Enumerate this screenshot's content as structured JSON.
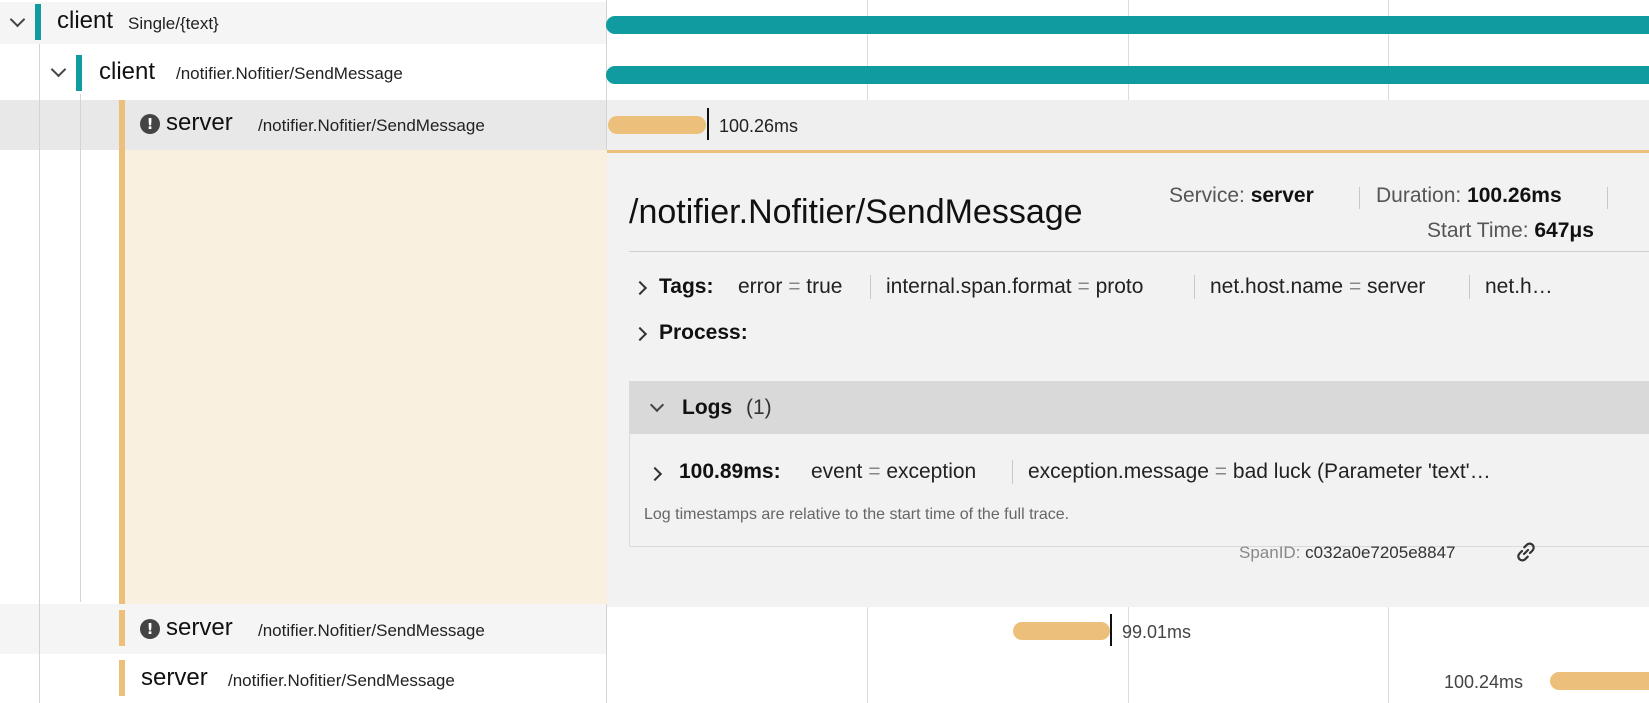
{
  "rows": [
    {
      "service": "client",
      "operation": "Single/{text}",
      "color": "#109ba0",
      "expanded": true,
      "error": false
    },
    {
      "service": "client",
      "operation": "/notifier.Nofitier/SendMessage",
      "color": "#109ba0",
      "expanded": true,
      "error": false
    },
    {
      "service": "server",
      "operation": "/notifier.Nofitier/SendMessage",
      "color": "#ecc07a",
      "error": true,
      "duration": "100.26ms"
    },
    {
      "service": "server",
      "operation": "/notifier.Nofitier/SendMessage",
      "color": "#ecc07a",
      "error": true,
      "duration": "99.01ms"
    },
    {
      "service": "server",
      "operation": "/notifier.Nofitier/SendMessage",
      "color": "#ecc07a",
      "error": false,
      "duration": "100.24ms"
    }
  ],
  "error_glyph": "!",
  "detail": {
    "title": "/notifier.Nofitier/SendMessage",
    "service_label": "Service:",
    "service_value": "server",
    "duration_label": "Duration:",
    "duration_value": "100.26ms",
    "start_label": "Start Time:",
    "start_value": "647μs",
    "tags_label": "Tags:",
    "tags": [
      {
        "key": "error",
        "value": "true"
      },
      {
        "key": "internal.span.format",
        "value": "proto"
      },
      {
        "key": "net.host.name",
        "value": "server"
      },
      {
        "key": "net.h…",
        "value": ""
      }
    ],
    "process_label": "Process:",
    "logs_label": "Logs",
    "logs_count": "(1)",
    "log_entry": {
      "time": "100.89ms:",
      "fields": [
        {
          "key": "event",
          "value": "exception"
        },
        {
          "key": "exception.message",
          "value": "bad luck (Parameter 'text'…"
        }
      ]
    },
    "logs_note": "Log timestamps are relative to the start time of the full trace.",
    "span_id_label": "SpanID:",
    "span_id_value": "c032a0e7205e8847"
  },
  "colors": {
    "client": "#109ba0",
    "server": "#ecc07a",
    "selected_left_bg": "#faf0df"
  }
}
